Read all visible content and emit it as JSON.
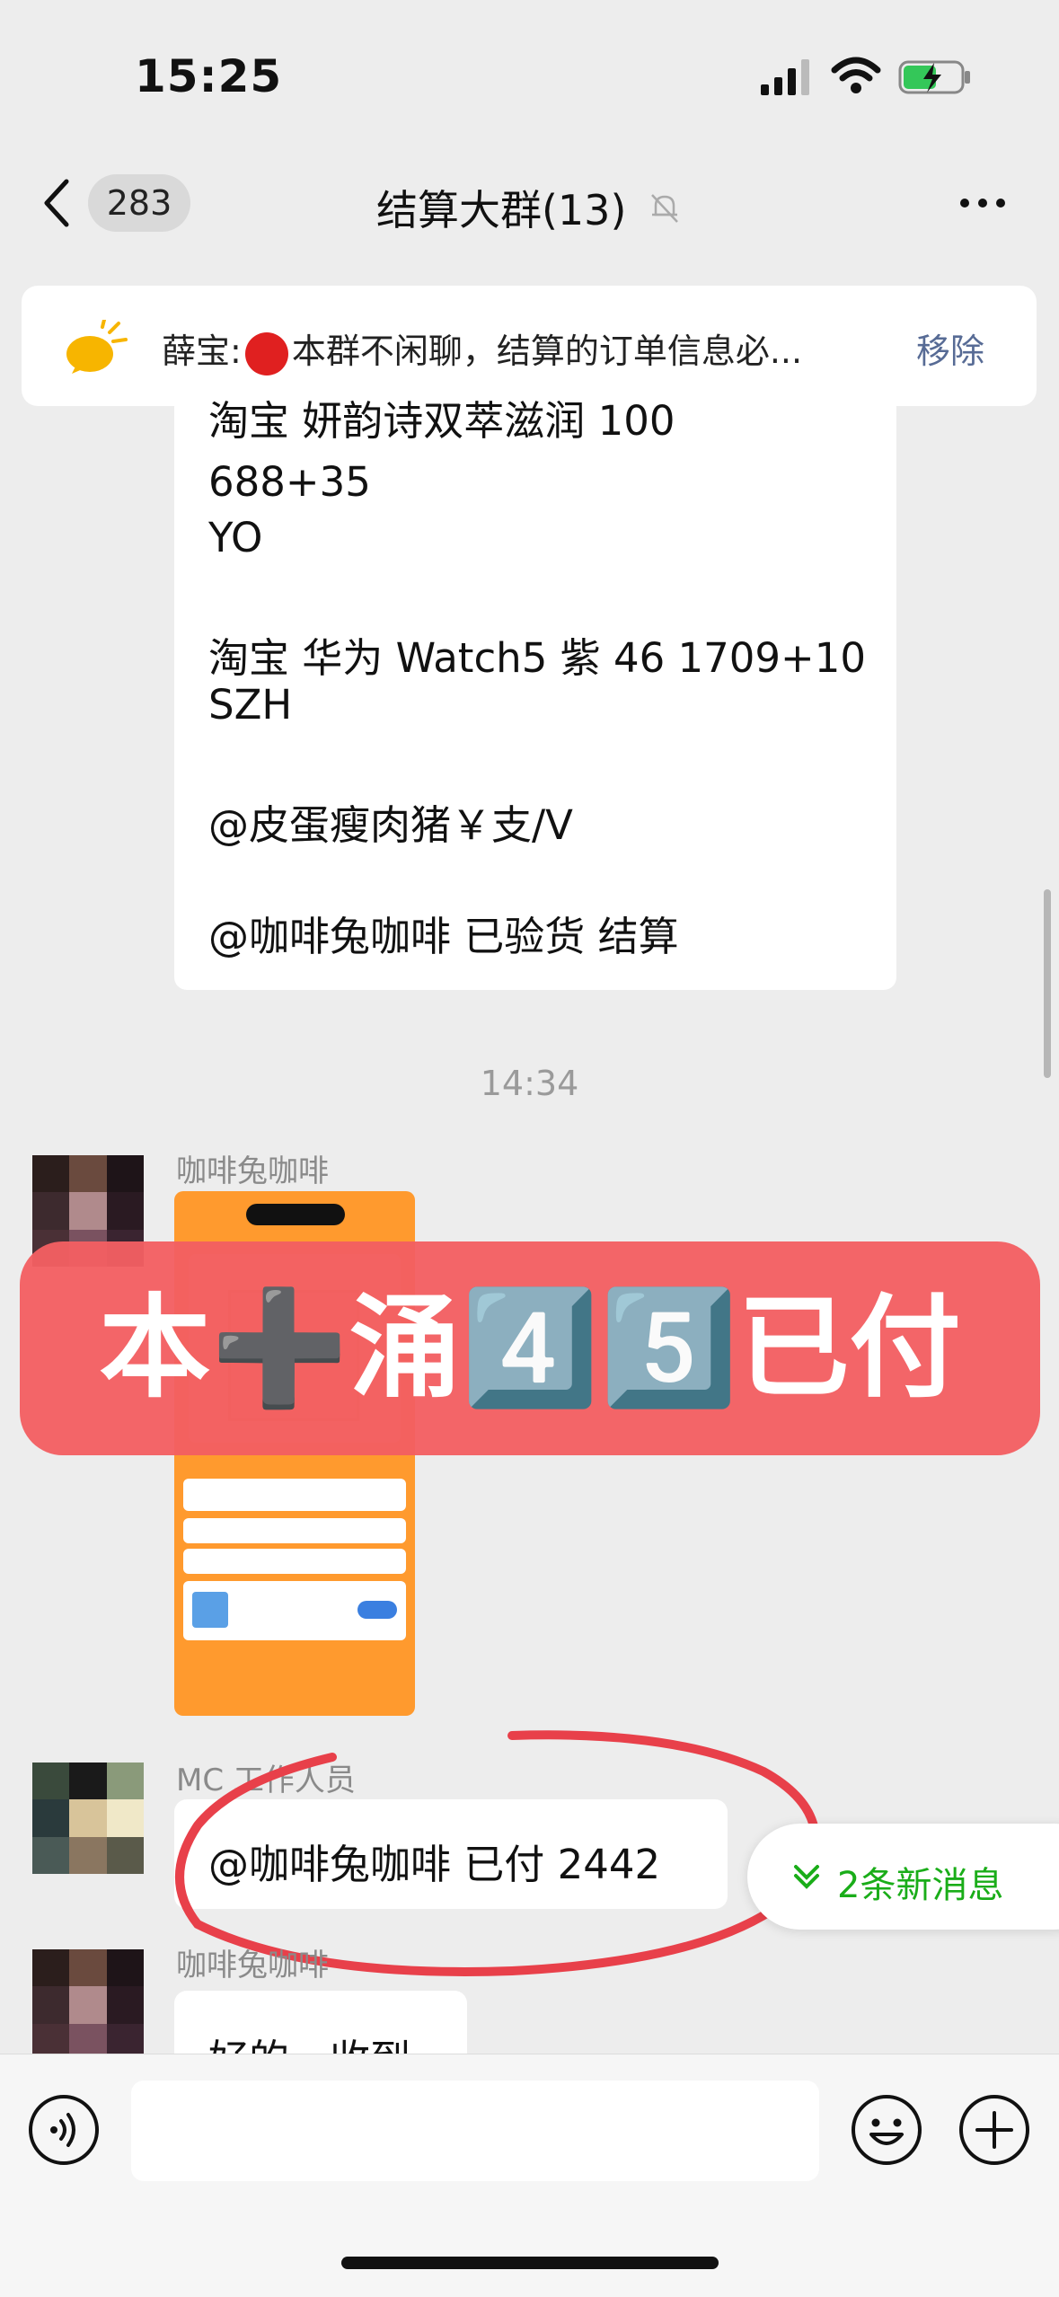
{
  "status_bar": {
    "time": "15:25"
  },
  "nav": {
    "unread_count": "283",
    "title": "结算大群(13)"
  },
  "pinned": {
    "sender": "薛宝:",
    "text": "本群不闲聊，结算的订单信息必...",
    "remove_label": "移除"
  },
  "message1": {
    "lines": [
      "淘宝 妍韵诗双萃滋润 100",
      "688+35",
      "YO",
      "",
      "淘宝 华为 Watch5 紫 46 1709+10",
      "SZH",
      "",
      " @皮蛋瘦肉猪￥支/V",
      "",
      " @咖啡兔咖啡 已验货  结算"
    ]
  },
  "timestamp": "14:34",
  "message_image": {
    "sender": "咖啡兔咖啡"
  },
  "overlay": {
    "text": "本➕涌4️⃣5️⃣已付"
  },
  "message2": {
    "sender": "MC 工作人员",
    "text": "@咖啡兔咖啡 已付 2442"
  },
  "new_messages": {
    "label": "2条新消息"
  },
  "message3": {
    "sender": "咖啡兔咖啡",
    "text": "好的，收到"
  },
  "colors": {
    "accent_green": "#1aad19",
    "overlay_red": "#f25f62",
    "link_blue": "#576b95",
    "circle_red": "#e8404a"
  }
}
